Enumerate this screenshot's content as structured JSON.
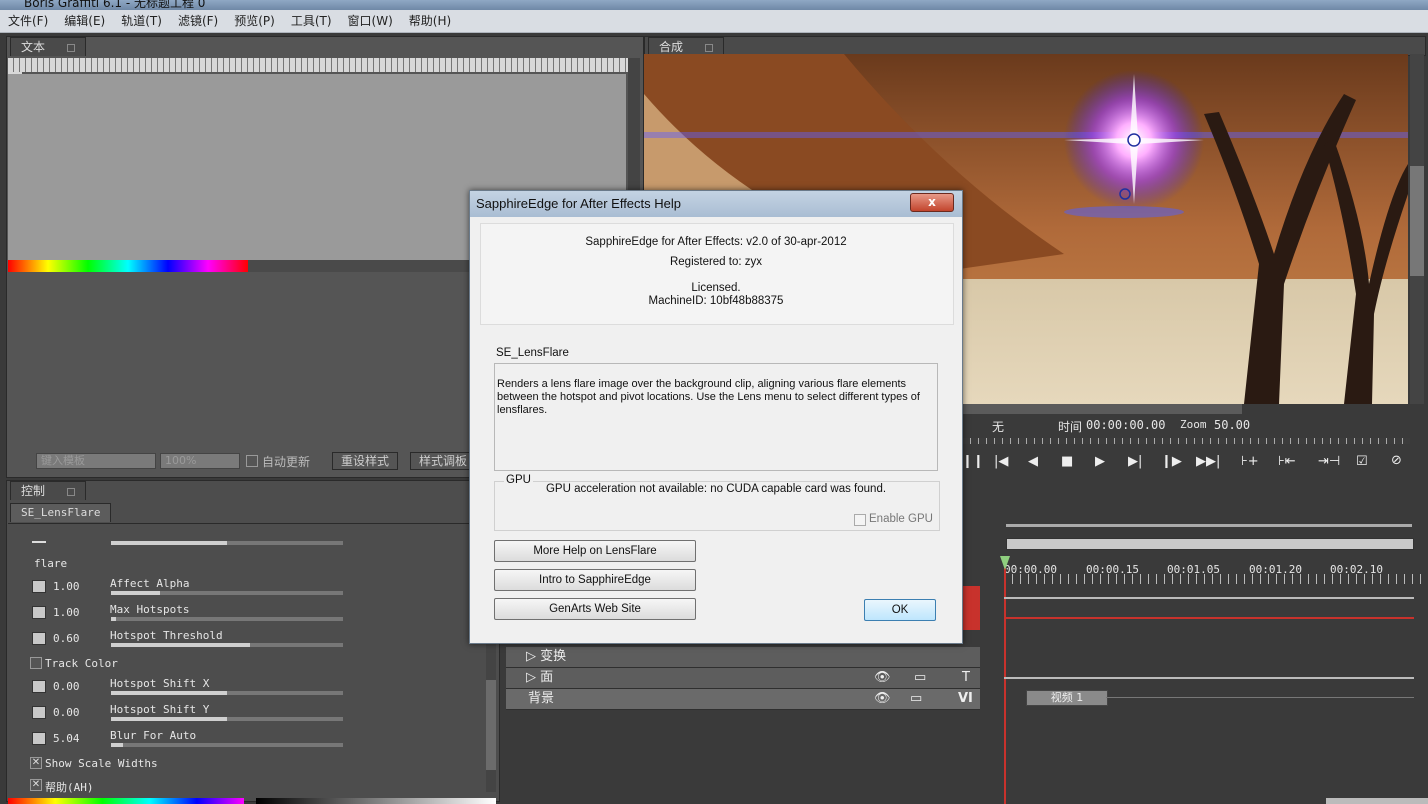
{
  "app": {
    "title": "Boris Graffiti 6.1 - 无标题工程 0"
  },
  "menu": {
    "items": [
      "文件(F)",
      "编辑(E)",
      "轨道(T)",
      "滤镜(F)",
      "预览(P)",
      "工具(T)",
      "窗口(W)",
      "帮助(H)"
    ]
  },
  "text_panel": {
    "tab": "文本",
    "input_placeholder": "键入模板",
    "zoom_value": "100%",
    "auto_update_label": "自动更新",
    "reset_style_button": "重设样式",
    "style_adjust_button": "样式调板"
  },
  "composite_panel": {
    "tab": "合成",
    "field_none": "无",
    "time_label": "时间",
    "time_value": "00:00:00.00",
    "zoom_label": "Zoom",
    "zoom_value": "50.00"
  },
  "control_panel": {
    "tab": "控制",
    "subtab": "SE_LensFlare",
    "flare_label": "flare",
    "params": [
      {
        "value": "1.00",
        "label": "Affect Alpha",
        "fill": 0.21
      },
      {
        "value": "1.00",
        "label": "Max Hotspots",
        "fill": 0.02
      },
      {
        "value": "0.60",
        "label": "Hotspot Threshold",
        "fill": 0.6
      },
      {
        "value": "0.00",
        "label": "Hotspot Shift X",
        "fill": 0.5
      },
      {
        "value": "0.00",
        "label": "Hotspot Shift Y",
        "fill": 0.5
      },
      {
        "value": "5.04",
        "label": "Blur For Auto",
        "fill": 0.05
      }
    ],
    "track_color_label": "Track Color",
    "show_scale_widths_label": "Show Scale Widths",
    "help_label": "帮助(AH)"
  },
  "timeline": {
    "times": [
      "00:00.00",
      "00:00.15",
      "00:01.05",
      "00:01.20",
      "00:02.10"
    ],
    "tracks": [
      "变换",
      "面",
      "背景"
    ],
    "clip_label": "视频 1"
  },
  "dialog": {
    "title": "SapphireEdge for After Effects Help",
    "close_label": "x",
    "version_line": "SapphireEdge for After Effects: v2.0 of 30-apr-2012",
    "registered_line": "Registered to:  zyx",
    "licensed_line": "Licensed.",
    "machine_line": "MachineID: 10bf48b88375",
    "effect_name": "SE_LensFlare",
    "effect_desc": "Renders a lens flare image over the background clip, aligning various flare elements between the hotspot and pivot locations.  Use the Lens menu to select different types of lensflares.",
    "gpu_group_label": "GPU",
    "gpu_message": "GPU acceleration not available: no CUDA capable card was found.",
    "enable_gpu_label": "Enable GPU",
    "buttons": [
      "More Help on LensFlare",
      "Intro to SapphireEdge",
      "GenArts Web Site"
    ],
    "ok_label": "OK"
  },
  "colors": {
    "panel_bg": "#5a5a5a",
    "dialog_bg": "#f0f0f0",
    "accent_red": "#c8322c"
  }
}
